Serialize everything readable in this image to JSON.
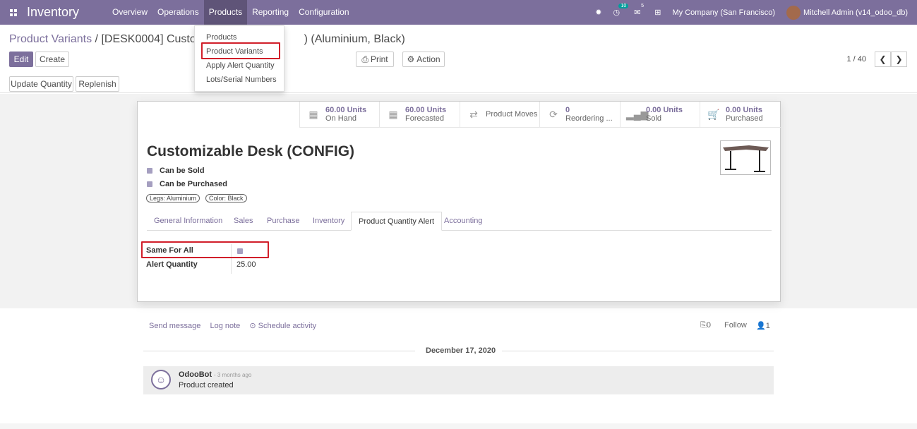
{
  "navbar": {
    "app_name": "Inventory",
    "menu": [
      "Overview",
      "Operations",
      "Products",
      "Reporting",
      "Configuration"
    ],
    "activity_count": "10",
    "messages_count": "5",
    "company": "My Company (San Francisco)",
    "user": "Mitchell Admin (v14_odoo_db)"
  },
  "breadcrumb": {
    "parent": "Product Variants",
    "separator": "/",
    "current_left": "[DESK0004] Customiz",
    "current_right": ") (Aluminium, Black)"
  },
  "buttons": {
    "edit": "Edit",
    "create": "Create",
    "print": "Print",
    "action": "Action",
    "update_quantity": "Update Quantity",
    "replenish": "Replenish"
  },
  "pager": "1 / 40",
  "dropdown": [
    "Products",
    "Product Variants",
    "Apply Alert Quantity",
    "Lots/Serial Numbers"
  ],
  "stats": [
    {
      "value": "60.00 Units",
      "label": "On Hand"
    },
    {
      "value": "60.00 Units",
      "label": "Forecasted"
    },
    {
      "value": "",
      "label": "Product Moves"
    },
    {
      "value": "0",
      "label": "Reordering ..."
    },
    {
      "value": "0.00 Units",
      "label": "Sold"
    },
    {
      "value": "0.00 Units",
      "label": "Purchased"
    }
  ],
  "product": {
    "title": "Customizable Desk (CONFIG)",
    "can_be_sold": "Can be Sold",
    "can_be_purchased": "Can be Purchased",
    "tags": [
      "Legs: Aluminium",
      "Color: Black"
    ]
  },
  "tabs": [
    "General Information",
    "Sales",
    "Purchase",
    "Inventory",
    "Product Quantity Alert",
    "Accounting"
  ],
  "alert_fields": {
    "same_for_all_label": "Same For All",
    "alert_quantity_label": "Alert Quantity",
    "alert_quantity_value": "25.00"
  },
  "chatter": {
    "send_message": "Send message",
    "log_note": "Log note",
    "schedule_activity": "Schedule activity",
    "attachments": "0",
    "follow": "Follow",
    "followers": "1",
    "date": "December 17, 2020",
    "author": "OdooBot",
    "time": "- 3 months ago",
    "body": "Product created"
  },
  "colors": {
    "brand": "#7c6f9c",
    "highlight": "#d11f2a",
    "badge": "#00a09d"
  }
}
